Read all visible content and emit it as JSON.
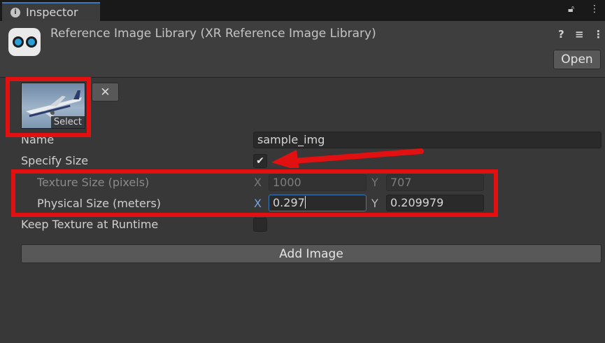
{
  "tab": {
    "label": "Inspector",
    "icon": "info-icon"
  },
  "tab_controls": {
    "lock_icon": "lock-icon",
    "menu_icon": "kebab-menu-icon"
  },
  "header": {
    "title": "Reference Image Library (XR Reference Image Library)",
    "asset_icon": "xr-reference-library-icon",
    "help_icon": "help-icon",
    "presets_icon": "presets-icon",
    "menu_icon": "kebab-menu-icon",
    "open_label": "Open"
  },
  "image_entry": {
    "thumbnail_icon": "airplane-image-thumbnail",
    "select_label": "Select",
    "remove_label": "✕",
    "name_label": "Name",
    "name_value": "sample_img",
    "specify_size_label": "Specify Size",
    "specify_size_checked": true,
    "texture_size_label": "Texture Size (pixels)",
    "texture_x_label": "X",
    "texture_x_value": "1000",
    "texture_y_label": "Y",
    "texture_y_value": "707",
    "physical_size_label": "Physical Size (meters)",
    "physical_x_label": "X",
    "physical_x_value": "0.297",
    "physical_y_label": "Y",
    "physical_y_value": "0.209979",
    "keep_texture_label": "Keep Texture at Runtime",
    "keep_texture_checked": false
  },
  "add_image_label": "Add Image",
  "colors": {
    "background": "#383838",
    "annotation_red": "#e21010",
    "focus_blue": "#3a79bb"
  }
}
